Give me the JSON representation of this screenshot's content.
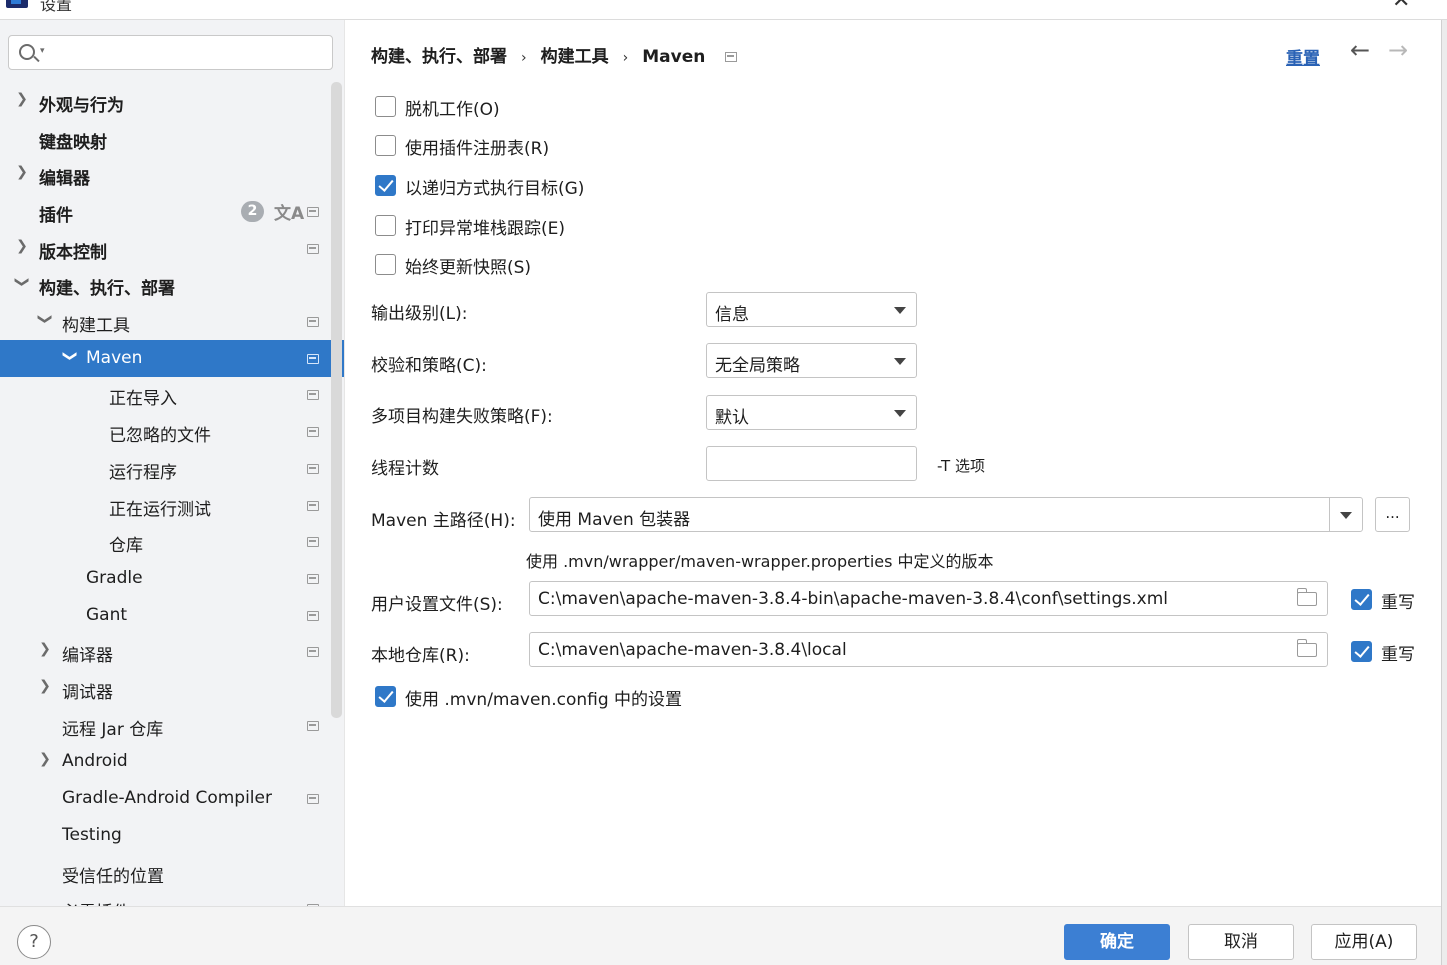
{
  "window": {
    "title": "设置"
  },
  "search": {
    "placeholder": ""
  },
  "sidebar": {
    "items": [
      {
        "label": "外观与行为"
      },
      {
        "label": "键盘映射"
      },
      {
        "label": "编辑器"
      },
      {
        "label": "插件",
        "badge": "2"
      },
      {
        "label": "版本控制"
      },
      {
        "label": "构建、执行、部署"
      },
      {
        "label": "构建工具"
      },
      {
        "label": "Maven"
      },
      {
        "label": "正在导入"
      },
      {
        "label": "已忽略的文件"
      },
      {
        "label": "运行程序"
      },
      {
        "label": "正在运行测试"
      },
      {
        "label": "仓库"
      },
      {
        "label": "Gradle"
      },
      {
        "label": "Gant"
      },
      {
        "label": "编译器"
      },
      {
        "label": "调试器"
      },
      {
        "label": "远程 Jar 仓库"
      },
      {
        "label": "Android"
      },
      {
        "label": "Gradle-Android Compiler"
      },
      {
        "label": "Testing"
      },
      {
        "label": "受信任的位置"
      },
      {
        "label": "必需插件"
      }
    ]
  },
  "header": {
    "breadcrumb": [
      "构建、执行、部署",
      "构建工具",
      "Maven"
    ],
    "separator": "›",
    "reset_label": "重置"
  },
  "options": {
    "offline": {
      "label": "脱机工作(O)",
      "checked": false
    },
    "plugin_registry": {
      "label": "使用插件注册表(R)",
      "checked": false
    },
    "recursive": {
      "label": "以递归方式执行目标(G)",
      "checked": true
    },
    "print_stack": {
      "label": "打印异常堆栈跟踪(E)",
      "checked": false
    },
    "always_update": {
      "label": "始终更新快照(S)",
      "checked": false
    }
  },
  "form": {
    "output_level": {
      "label": "输出级别(L):",
      "value": "信息"
    },
    "checksum_policy": {
      "label": "校验和策略(C):",
      "value": "无全局策略"
    },
    "multiproject_fail": {
      "label": "多项目构建失败策略(F):",
      "value": "默认"
    },
    "thread_count": {
      "label": "线程计数",
      "value": "",
      "hint": "-T 选项"
    },
    "maven_home": {
      "label": "Maven 主路径(H):",
      "value": "使用 Maven 包装器",
      "browse_label": "...",
      "hint": "使用 .mvn/wrapper/maven-wrapper.properties 中定义的版本"
    },
    "user_settings": {
      "label": "用户设置文件(S):",
      "value": "C:\\maven\\apache-maven-3.8.4-bin\\apache-maven-3.8.4\\conf\\settings.xml",
      "override_label": "重写",
      "override_checked": true
    },
    "local_repo": {
      "label": "本地仓库(R):",
      "value": "C:\\maven\\apache-maven-3.8.4\\local",
      "override_label": "重写",
      "override_checked": true
    },
    "use_mvn_config": {
      "label": "使用 .mvn/maven.config 中的设置",
      "checked": true
    }
  },
  "footer": {
    "help_label": "?",
    "ok_label": "确定",
    "cancel_label": "取消",
    "apply_label": "应用(A)"
  },
  "colors": {
    "accent": "#2f78c8",
    "primary_button": "#3c7fd3",
    "link": "#2a62b5",
    "sidebar_bg": "#f2f3f5"
  }
}
